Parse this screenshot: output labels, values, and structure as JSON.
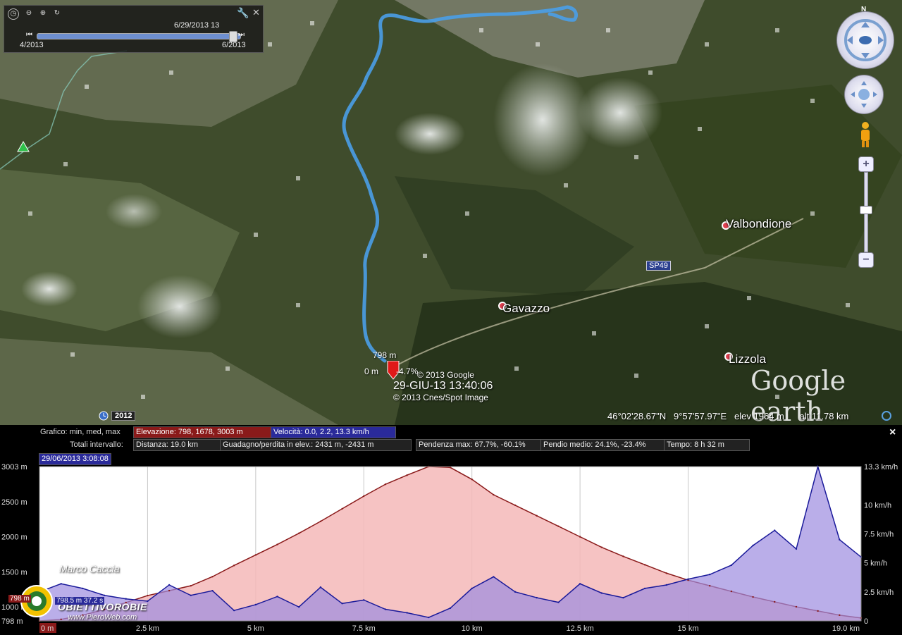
{
  "timeslider": {
    "current": "6/29/2013 13",
    "start": "4/2013",
    "end": "6/2013"
  },
  "map": {
    "places": [
      {
        "name": "Valbondione"
      },
      {
        "name": "Gavazzo"
      },
      {
        "name": "Lizzola"
      }
    ],
    "road_badge": "SP49",
    "track_labels": {
      "elev": "798 m",
      "dist": "0 m",
      "slope": "-4.7%"
    },
    "credits": {
      "google": "© 2013 Google",
      "timestamp": "29-GIU-13 13:40:06",
      "spot": "© 2013 Cnes/Spot Image"
    },
    "historical_year": "2012",
    "logo": "Google earth",
    "track_color": "#4a9ee8"
  },
  "status_bar": {
    "lat": "46°02'28.67\"N",
    "lon": "9°57'57.97\"E",
    "elev": "elev  1964 m",
    "alt": "alt  11.78 km"
  },
  "profile_info": {
    "row1_label": "Grafico: min, med, max",
    "elevation": "Elevazione: 798, 1678, 3003 m",
    "speed": "Velocità: 0.0, 2.2, 13.3 km/h",
    "row2_label": "Totali intervallo:",
    "distance": "Distanza: 19.0 km",
    "gain_loss": "Guadagno/perdita in elev.: 2431 m, -2431 m",
    "max_slope": "Pendenza max: 67.7%, -60.1%",
    "avg_slope": "Pendio medio: 24.1%, -23.4%",
    "time": "Tempo: 8 h 32 m",
    "date_tag": "29/06/2013 3:08:08",
    "close": "×"
  },
  "watermark": {
    "author": "Marco Caccia",
    "brand": "OBIETTIVOROBIE",
    "site": "www.PieroWeb.com",
    "hover_elev": "798 m",
    "hover_readout": "798.5 m  37.2 s"
  },
  "chart_data": {
    "type": "area",
    "x": [
      0,
      0.5,
      1,
      1.5,
      2,
      2.5,
      3,
      3.5,
      4,
      4.5,
      5,
      5.5,
      6,
      6.5,
      7,
      7.5,
      8,
      8.5,
      9,
      9.5,
      10,
      10.5,
      11,
      11.5,
      12,
      12.5,
      13,
      13.5,
      14,
      14.5,
      15,
      15.5,
      16,
      16.5,
      17,
      17.5,
      18,
      18.5,
      19
    ],
    "series": [
      {
        "name": "Elevazione",
        "axis": "left",
        "color": "#8a1a1a",
        "values": [
          798,
          820,
          880,
          960,
          1060,
          1160,
          1230,
          1300,
          1430,
          1590,
          1740,
          1890,
          2050,
          2220,
          2400,
          2580,
          2750,
          2880,
          3003,
          2990,
          2820,
          2600,
          2450,
          2300,
          2150,
          2000,
          1850,
          1720,
          1600,
          1480,
          1380,
          1300,
          1220,
          1140,
          1070,
          1000,
          940,
          880,
          840
        ]
      },
      {
        "name": "Velocità",
        "axis": "right",
        "color": "#1a1a9a",
        "values": [
          2.5,
          3.2,
          2.8,
          2.2,
          1.9,
          1.7,
          3.1,
          2.2,
          2.6,
          0.9,
          1.4,
          2.1,
          1.2,
          2.9,
          1.5,
          1.8,
          1.0,
          0.7,
          0.3,
          1.1,
          2.8,
          3.8,
          2.5,
          2.0,
          1.6,
          3.2,
          2.4,
          2.0,
          2.8,
          3.1,
          3.6,
          4.0,
          4.8,
          6.5,
          7.8,
          6.2,
          13.3,
          7.0,
          5.5
        ]
      }
    ],
    "x_ticks": [
      "0 m",
      "2.5 km",
      "5 km",
      "7.5 km",
      "10 km",
      "12.5 km",
      "15 km",
      "19.0 km"
    ],
    "x_tick_values": [
      0,
      2.5,
      5,
      7.5,
      10,
      12.5,
      15,
      19
    ],
    "y_left_ticks": [
      "3003 m",
      "2500 m",
      "2000 m",
      "1500 m",
      "1000 m",
      "798 m"
    ],
    "y_left_values": [
      3003,
      2500,
      2000,
      1500,
      1000,
      798
    ],
    "y_right_ticks": [
      "13.3 km/h",
      "10 km/h",
      "7.5 km/h",
      "5 km/h",
      "2.5 km/h",
      "0"
    ],
    "y_right_values": [
      13.3,
      10,
      7.5,
      5,
      2.5,
      0
    ],
    "xlim": [
      0,
      19
    ],
    "ylim_left": [
      798,
      3003
    ],
    "ylim_right": [
      0,
      13.3
    ],
    "grid": true
  }
}
